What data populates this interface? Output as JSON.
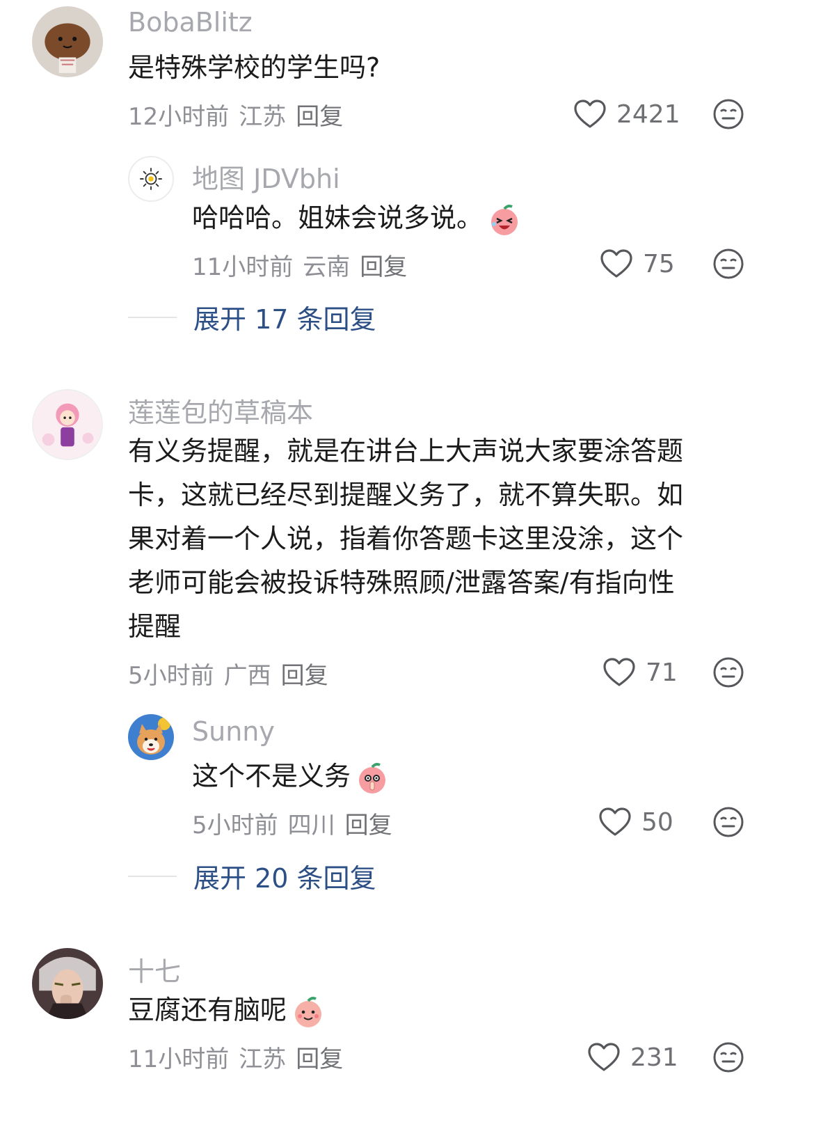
{
  "colors": {
    "username": "#a6a8ad",
    "text": "#1b1b1b",
    "meta": "#8e9095",
    "expand_link": "#2c4f86",
    "icon_stroke": "#55575b"
  },
  "comments": [
    {
      "username": "BobaBlitz",
      "text_lines": [
        "是特殊学校的学生吗?"
      ],
      "time": "12小时前",
      "location": "江苏",
      "reply_label": "回复",
      "likes": "2421",
      "avatar_icon": "bread-plush-avatar",
      "replies": [
        {
          "username": "地图 JDVbhi",
          "text": "哈哈哈。姐妹会说多说。",
          "emoji": "laughing-peach-emoji",
          "time": "11小时前",
          "location": "云南",
          "reply_label": "回复",
          "likes": "75",
          "avatar_icon": "sun-avatar"
        }
      ],
      "expand_label": "展开 17 条回复"
    },
    {
      "username": "莲莲包的草稿本",
      "text_lines": [
        "有义务提醒，就是在讲台上大声说大家要涂答题",
        "卡，这就已经尽到提醒义务了，就不算失职。如",
        "果对着一个人说，指着你答题卡这里没涂，这个",
        "老师可能会被投诉特殊照顾/泄露答案/有指向性",
        "提醒"
      ],
      "time": "5小时前",
      "location": "广西",
      "reply_label": "回复",
      "likes": "71",
      "avatar_icon": "pink-cartoon-girl-avatar",
      "replies": [
        {
          "username": "Sunny",
          "text": "这个不是义务",
          "emoji": "shushing-peach-emoji",
          "time": "5小时前",
          "location": "四川",
          "reply_label": "回复",
          "likes": "50",
          "avatar_icon": "shiba-dog-avatar"
        }
      ],
      "expand_label": "展开 20 条回复"
    },
    {
      "username": "十七",
      "text_lines": [
        "豆腐还有脑呢"
      ],
      "emoji": "smiling-peach-emoji",
      "time": "11小时前",
      "location": "江苏",
      "reply_label": "回复",
      "likes": "231",
      "avatar_icon": "anime-character-avatar",
      "replies": []
    }
  ]
}
